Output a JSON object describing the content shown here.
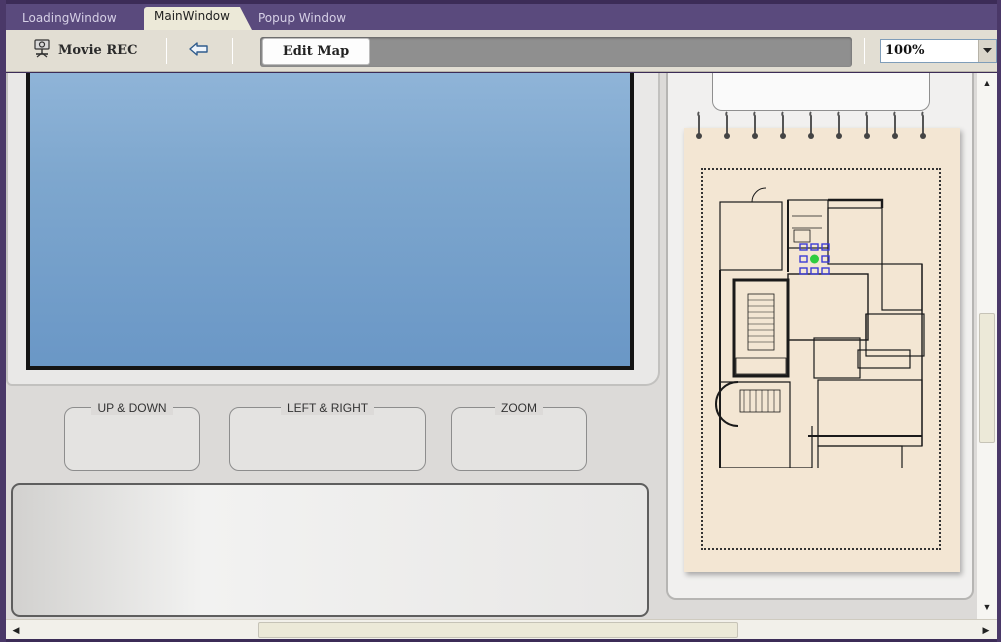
{
  "tabs": [
    {
      "label": "LoadingWindow",
      "active": false
    },
    {
      "label": "MainWindow",
      "active": true
    },
    {
      "label": "Popup Window",
      "active": false
    }
  ],
  "toolbar": {
    "movie_rec_label": "Movie REC",
    "movie_icon": "camera-icon",
    "back_icon": "back-arrow-icon",
    "edit_map_label": "Edit Map",
    "zoom_value": "100%"
  },
  "controls": {
    "up_down_label": "UP & DOWN",
    "left_right_label": "LEFT & RIGHT",
    "zoom_label": "ZOOM"
  },
  "colors": {
    "accent_purple": "#3c2c57",
    "video_blue": "#7ea7ce",
    "notebook_paper": "#f3e6d3",
    "camera_marker": "#2ecc40"
  }
}
